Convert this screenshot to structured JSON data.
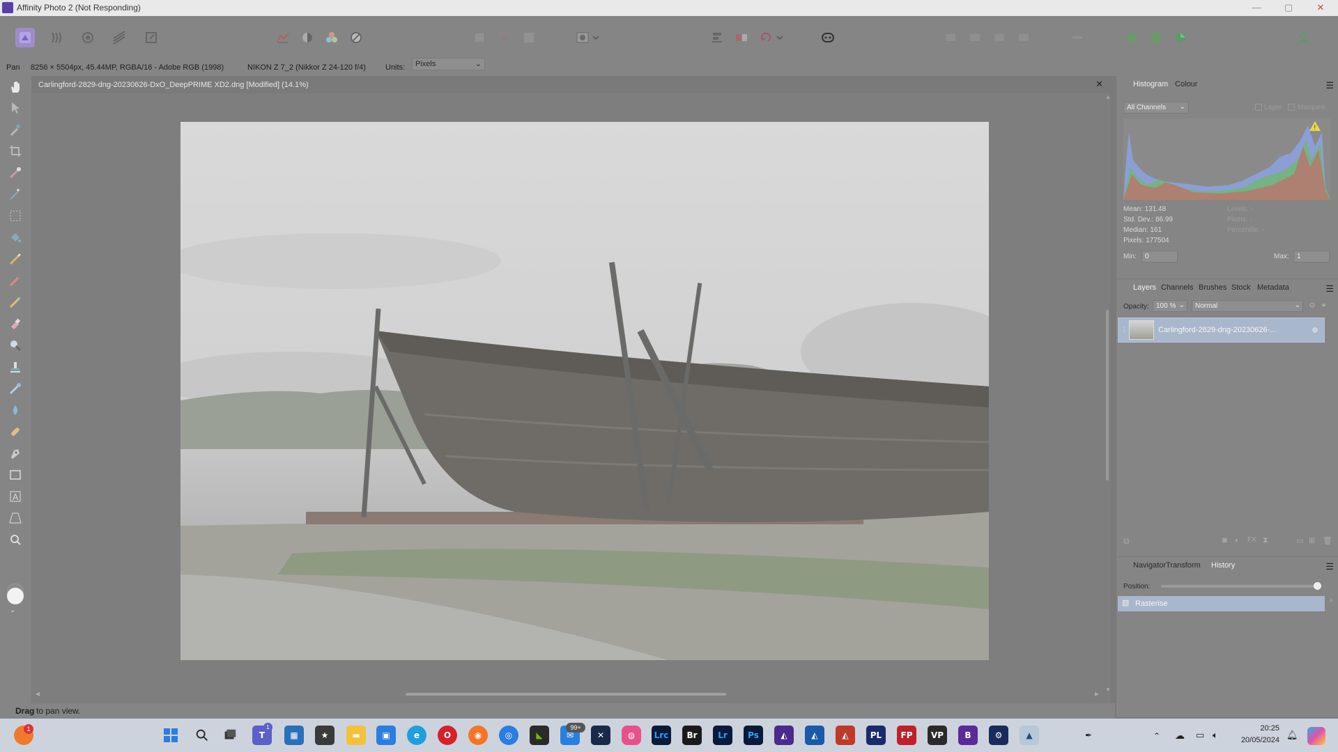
{
  "window": {
    "title": "Affinity Photo 2 (Not Responding)",
    "minimize": "—",
    "maximize": "▢",
    "close": "✕"
  },
  "context_bar": {
    "tool": "Pan",
    "image_info": "8256 × 5504px, 45.44MP, RGBA/16 - Adobe RGB (1998)",
    "camera": "NIKON Z 7_2 (Nikkor Z 24-120 f/4)",
    "units_label": "Units:",
    "units_value": "Pixels"
  },
  "document": {
    "tab_title": "Carlingford-2829-dng-20230626-DxO_DeepPRIME XD2.dng [Modified] (14.1%)",
    "close": "✕"
  },
  "status_bar": {
    "bold": "Drag",
    "text": " to pan view."
  },
  "histogram_panel": {
    "tabs": [
      "Histogram",
      "Colour"
    ],
    "active_tab": "Histogram",
    "channel_select": "All Channels",
    "layer_label": "Layer",
    "marquee_label": "Marquee",
    "stats_left": [
      "Mean: 131.48",
      "Std. Dev.: 86.99",
      "Median: 161",
      "Pixels: 177504"
    ],
    "stats_right": [
      "Levels: -",
      "Pixels: -",
      "Percentile: -"
    ],
    "min_label": "Min:",
    "min_value": "0",
    "max_label": "Max:",
    "max_value": "1",
    "warning_color": "#e8d84a"
  },
  "layers_panel": {
    "tabs": [
      "Layers",
      "Channels",
      "Brushes",
      "Stock",
      "Metadata"
    ],
    "active_tab": "Layers",
    "opacity_label": "Opacity:",
    "opacity_value": "100 %",
    "blend_mode": "Normal",
    "layers": [
      {
        "name": "Carlingford-2829-dng-20230626-..."
      }
    ]
  },
  "history_panel": {
    "tabs": [
      "Navigator",
      "Transform",
      "History"
    ],
    "active_tab": "History",
    "position_label": "Position:",
    "position_value": 1.0,
    "entries": [
      "Rasterise"
    ]
  },
  "taskbar": {
    "time": "20:25",
    "date": "20/05/2024",
    "mail_badge": "99+",
    "teams_badge": "1",
    "notif_badge": "1",
    "apps": [
      "Lrc",
      "Br",
      "Lr",
      "Ps",
      "PL",
      "FP"
    ]
  }
}
